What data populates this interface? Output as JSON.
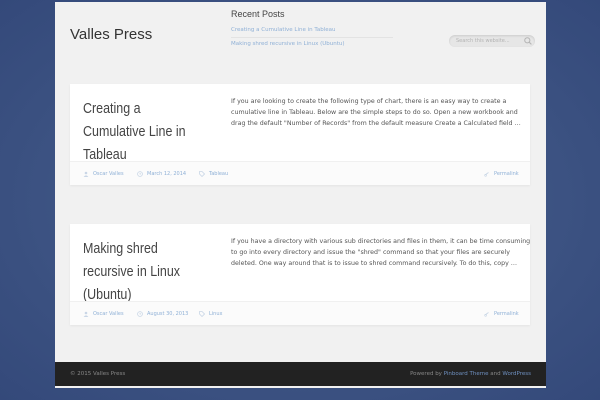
{
  "site": {
    "title": "Valles Press"
  },
  "recent_posts": {
    "heading": "Recent Posts",
    "items": [
      {
        "label": "Creating a Cumulative Line in Tableau"
      },
      {
        "label": "Making shred recursive in Linux (Ubuntu)"
      }
    ]
  },
  "search": {
    "placeholder": "Search this website..."
  },
  "posts": [
    {
      "title": "Creating a Cumulative Line in Tableau",
      "excerpt": "If you are looking to create the following type of chart, there is an easy way to create a cumulative line in Tableau. Below are the simple steps to do so. Open a new workbook and drag the default \"Number of Records\" from the default measure Create a Calculated field …",
      "author": "Oscar Valles",
      "date": "March 12, 2014",
      "category": "Tableau",
      "permalink": "Permalink"
    },
    {
      "title": "Making shred recursive in Linux (Ubuntu)",
      "excerpt": "If you have a directory with various sub directories and files in them, it can be time consuming to go into every directory and issue the \"shred\" command so that your files are securely deleted. One way around that is to issue to shred command recursively.  To do this, copy …",
      "author": "Oscar Valles",
      "date": "August 30, 2013",
      "category": "Linux",
      "permalink": "Permalink"
    }
  ],
  "footer": {
    "copyright": "© 2015 Valles Press",
    "powered_by": "Powered by",
    "theme_link": "Pinboard Theme",
    "and": "and",
    "wp_link": "WordPress"
  },
  "colors": {
    "background": "#3e5684",
    "link": "#8fb0d6",
    "footer": "#222222"
  }
}
